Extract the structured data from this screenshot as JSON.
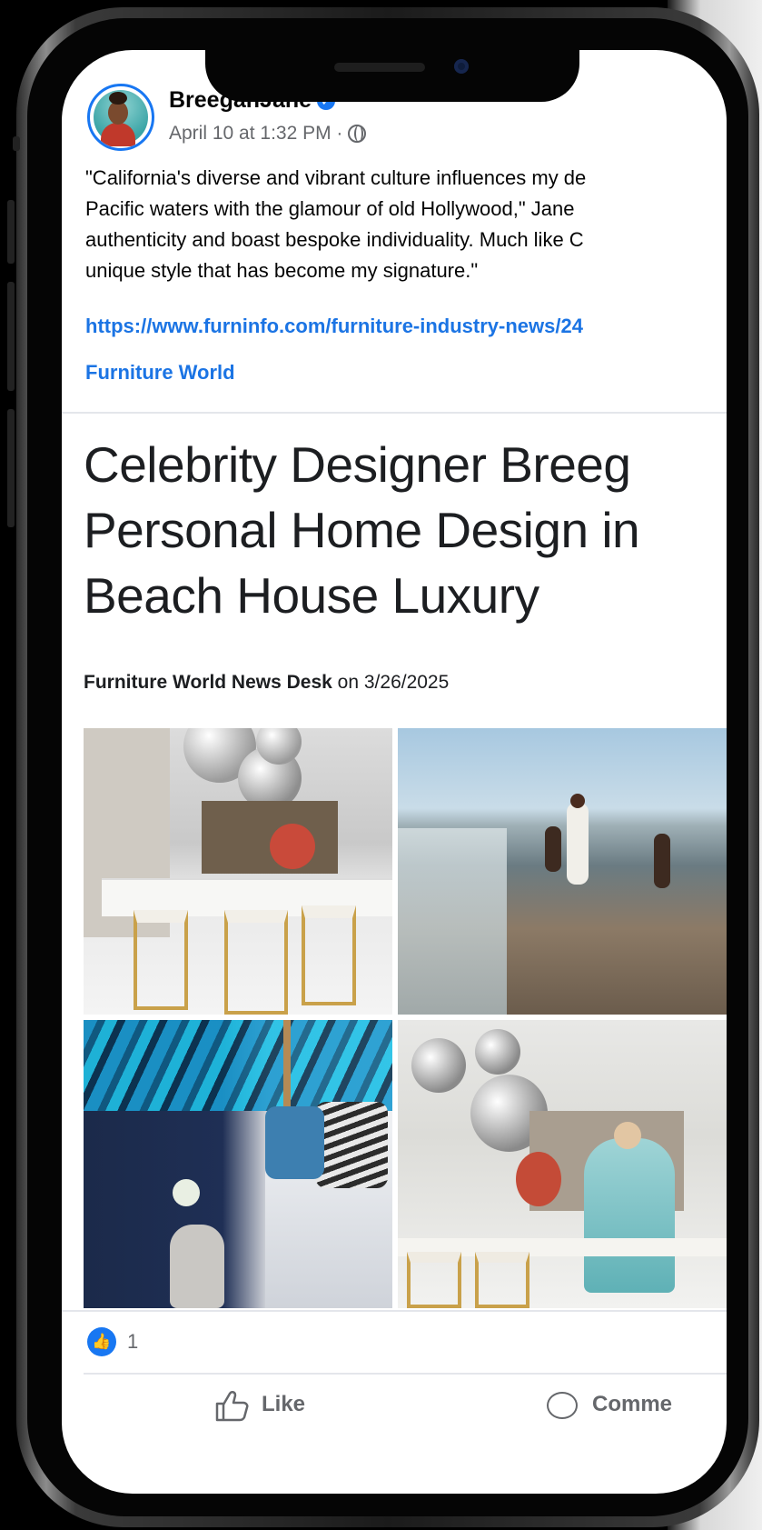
{
  "post": {
    "author": "BreeganJane",
    "timestamp": "April 10 at 1:32 PM ·",
    "visibility_icon": "globe-icon",
    "text_lines": [
      "\"California's diverse and vibrant culture influences my de",
      "Pacific waters with the glamour of old Hollywood,\" Jane",
      "authenticity and boast bespoke individuality. Much like C",
      "unique style that has become my signature.\""
    ],
    "link": "https://www.furninfo.com/furniture-industry-news/24",
    "source": "Furniture World"
  },
  "article": {
    "title_lines": [
      "Celebrity Designer Breeg",
      "Personal Home Design in",
      "Beach House Luxury"
    ],
    "byline_author": "Furniture World News Desk",
    "byline_date": " on 3/26/2025"
  },
  "reactions": {
    "count": "1"
  },
  "actions": {
    "like_label": "Like",
    "comment_label": "Comme"
  },
  "colors": {
    "accent": "#1877f2",
    "link": "#1b74e4",
    "secondary_text": "#65676b"
  }
}
